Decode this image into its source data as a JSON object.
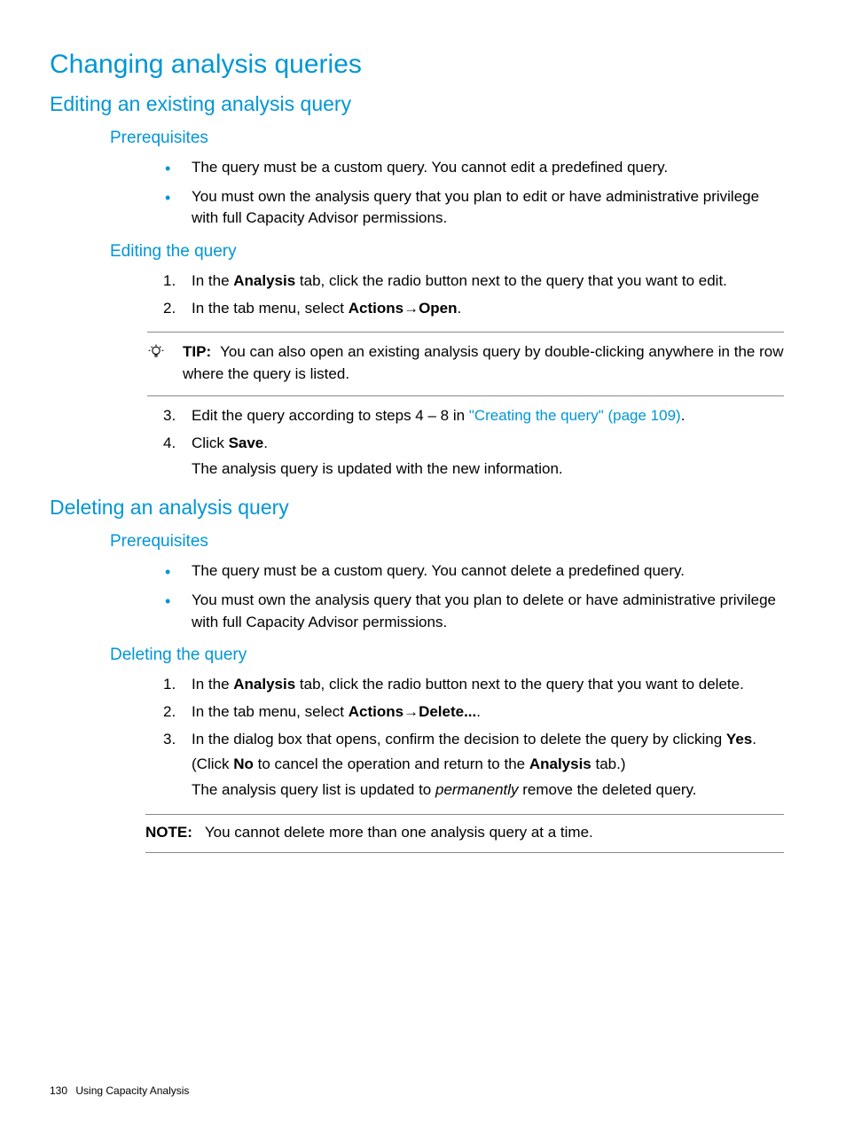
{
  "title": "Changing analysis queries",
  "section1": {
    "heading": "Editing an existing analysis query",
    "prereq_heading": "Prerequisites",
    "prereqs": [
      "The query must be a custom query. You cannot edit a predefined query.",
      "You must own the analysis query that you plan to edit or have administrative privilege with full Capacity Advisor permissions."
    ],
    "edit_heading": "Editing the query",
    "step1_pre": "In the ",
    "step1_bold": "Analysis",
    "step1_post": " tab, click the radio button next to the query that you want to edit.",
    "step2_pre": "In the tab menu, select ",
    "step2_b1": "Actions",
    "step2_arrow": "→",
    "step2_b2": "Open",
    "step2_post": ".",
    "tip_label": "TIP:",
    "tip_text": "You can also open an existing analysis query by double-clicking anywhere in the row where the query is listed.",
    "step3_pre": "Edit the query according to steps 4 – 8 in ",
    "step3_link": "\"Creating the query\" (page 109)",
    "step3_post": ".",
    "step4_pre": "Click ",
    "step4_bold": "Save",
    "step4_post": ".",
    "step4_sub": "The analysis query is updated with the new information."
  },
  "section2": {
    "heading": "Deleting an analysis query",
    "prereq_heading": "Prerequisites",
    "prereqs": [
      "The query must be a custom query. You cannot delete a predefined query.",
      "You must own the analysis query that you plan to delete or have administrative privilege with full Capacity Advisor permissions."
    ],
    "del_heading": "Deleting the query",
    "step1_pre": "In the ",
    "step1_bold": "Analysis",
    "step1_post": " tab, click the radio button next to the query that you want to delete.",
    "step2_pre": "In the tab menu, select ",
    "step2_b1": "Actions",
    "step2_arrow": "→",
    "step2_b2": "Delete...",
    "step2_post": ".",
    "step3_pre": "In the dialog box that opens, confirm the decision to delete the query by clicking ",
    "step3_bold": "Yes",
    "step3_post": ".",
    "step3_sub1_pre": "(Click ",
    "step3_sub1_b1": "No",
    "step3_sub1_mid": " to cancel the operation and return to the ",
    "step3_sub1_b2": "Analysis",
    "step3_sub1_post": " tab.)",
    "step3_sub2_pre": "The analysis query list is updated to ",
    "step3_sub2_italic": "permanently",
    "step3_sub2_post": " remove the deleted query.",
    "note_label": "NOTE:",
    "note_text": "You cannot delete more than one analysis query at a time."
  },
  "footer": {
    "page": "130",
    "chapter": "Using Capacity Analysis"
  }
}
